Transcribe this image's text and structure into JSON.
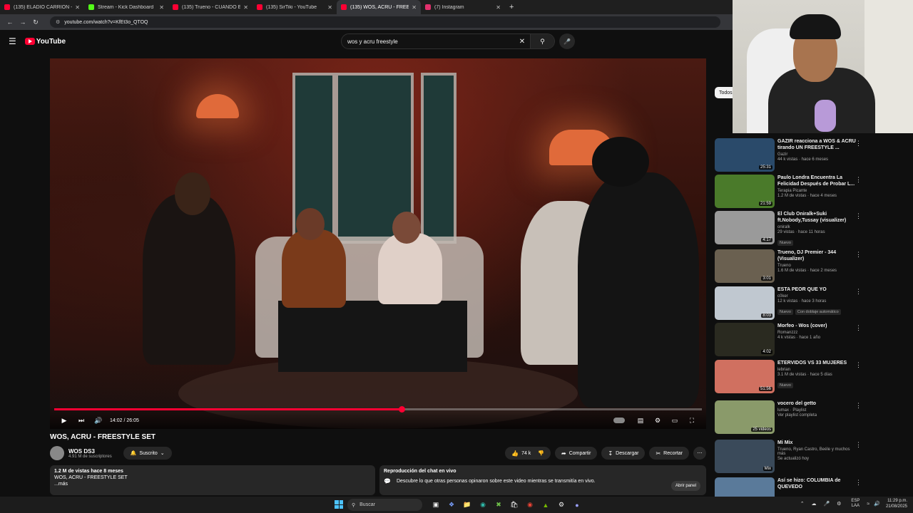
{
  "browser": {
    "tabs": [
      {
        "label": "(135) ELADIO CARRIÓN - RICK",
        "color": "#ff0033"
      },
      {
        "label": "Stream - Kick Dashboard",
        "color": "#53fc18"
      },
      {
        "label": "(135) Trueno - CUANDO EL BA",
        "color": "#ff0033"
      },
      {
        "label": "(135) SirTiki - YouTube",
        "color": "#ff0033"
      },
      {
        "label": "(135) WOS, ACRU - FREESTYLE",
        "color": "#ff0033"
      },
      {
        "label": "(7) Instagram",
        "color": "#e1306c"
      }
    ],
    "url": "youtube.com/watch?v=KfEt3o_QTOQ"
  },
  "youtube": {
    "logo": "YouTube",
    "search_value": "wos y acru freestyle"
  },
  "player": {
    "progress": 0.536,
    "time": "14:02 / 26:05"
  },
  "video": {
    "title": "WOS, ACRU - FREESTYLE SET",
    "channel": "WOS DS3",
    "subscribers": "4.91 M de suscriptores",
    "subscribed_label": "Suscrito",
    "likes": "74 k",
    "share_label": "Compartir",
    "download_label": "Descargar",
    "clip_label": "Recortar",
    "desc_stats": "1.2 M de vistas  hace 8 meses",
    "desc_text": "WOS, ACRU - FREESTYLE SET",
    "desc_more": "...más",
    "chat_title": "Reproducción del chat en vivo",
    "chat_text": "Descubre lo que otras personas opinaron sobre este video mientras se transmitía en vivo.",
    "chat_button": "Abrir panel"
  },
  "sidebar": {
    "chip": "Todos",
    "items": [
      {
        "title": "GAZIR reacciona a WOS & ACRU tirando UN FREESTYLE ...",
        "channel": "Gazir",
        "meta": "44 k vistas · hace 6 meses",
        "duration": "25:31",
        "badges": [],
        "thumb": "#2a4a6a"
      },
      {
        "title": "Paulo Londra Encuentra La Felicidad Después de Probar L...",
        "channel": "Terapia Picante",
        "meta": "1.2 M de vistas · hace 4 meses",
        "duration": "21:59",
        "badges": [],
        "thumb": "#4a7a2a"
      },
      {
        "title": "El Club Oniralk+Suki ft.Nobody,Tussay (visualizer)",
        "channel": "oniralk",
        "meta": "29 vistas · hace 11 horas",
        "duration": "4:17",
        "badges": [
          "Nuevo"
        ],
        "thumb": "#9a9a9a"
      },
      {
        "title": "Trueno, DJ Premier - 344 (Visualizer)",
        "channel": "Trueno",
        "meta": "1.6 M de vistas · hace 2 meses",
        "duration": "3:01",
        "badges": [],
        "thumb": "#6a6050"
      },
      {
        "title": "ESTA PEOR QUE YO",
        "channel": "c0ker",
        "meta": "12 k vistas · hace 3 horas",
        "duration": "8:03",
        "badges": [
          "Nuevo",
          "Con doblaje automático"
        ],
        "thumb": "#c0c8d0"
      },
      {
        "title": "Morfeo - Wos (cover)",
        "channel": "Romanzzz",
        "meta": "4 k vistas · hace 1 año",
        "duration": "4:02",
        "badges": [],
        "thumb": "#2a2a20"
      },
      {
        "title": "ETERVIDOS VS 33 MUJERES",
        "channel": "lebrian",
        "meta": "3.1 M de vistas · hace 5 días",
        "duration": "51:56",
        "badges": [
          "Nuevo"
        ],
        "thumb": "#d07060"
      },
      {
        "title": "vocero del getto",
        "channel": "lumax · Playlist",
        "meta": "Ver playlist completa",
        "duration": "25 videos",
        "badges": [],
        "thumb": "#8a9a6a"
      },
      {
        "title": "Mi Mix",
        "channel": "Trueno, Ryan Castro, Beéle y muchos más",
        "meta": "Se actualizó hoy",
        "duration": "Mix",
        "badges": [],
        "thumb": "#3a4a5a"
      },
      {
        "title": "Así se hizo: COLUMBIA de QUEVEDO",
        "channel": "",
        "meta": "",
        "duration": "",
        "badges": [],
        "thumb": "#5a7a9a"
      }
    ]
  },
  "taskbar": {
    "search": "Buscar",
    "lang_top": "ESP",
    "lang_bottom": "LAA",
    "time": "11:29 p.m.",
    "date": "21/08/2025"
  }
}
